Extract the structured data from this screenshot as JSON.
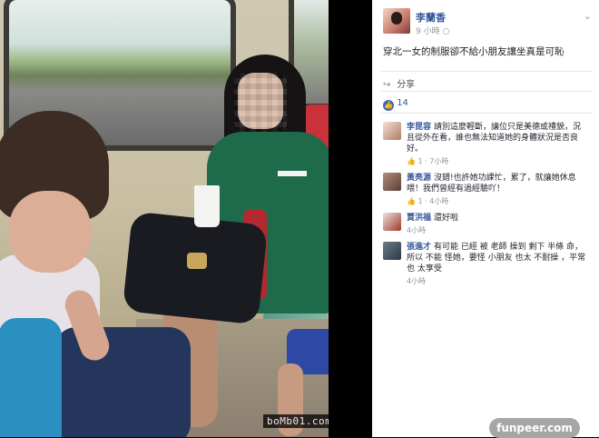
{
  "post": {
    "author": "李蘭香",
    "time": "9 小時",
    "privacy_icon": "globe-icon",
    "text": "穿北一女的制服卻不給小朋友讓坐真是可恥",
    "share_label": "分享",
    "like_count": "14"
  },
  "comments": [
    {
      "name": "李昆容",
      "text": "請別這麼輕斷，讓位只是美德或禮貌，況且從外在看，誰也無法知道她的身體狀況是否良好。",
      "like_count": "1",
      "time": "7小時"
    },
    {
      "name": "黃亮源",
      "text": "沒錯!也許她功課忙，累了，就讓她休息喂！我們曾經有過經驗吖！",
      "like_count": "1",
      "time": "4小時"
    },
    {
      "name": "賈洪福",
      "text": "還好啦",
      "like_count": "",
      "time": "4小時"
    },
    {
      "name": "張進才",
      "text": "有可能 已經 被 老師 操到 剩下 半條 命，所以 不能 怪她，要怪 小朋友 也太 不耐操 ，平常也 太享受",
      "like_count": "",
      "time": "4小時"
    }
  ],
  "watermarks": {
    "photo": "boMb01.com",
    "site": "funpeer.com"
  },
  "colors": {
    "link": "#365899",
    "like_blue": "#4267b2",
    "meta_gray": "#90949c"
  }
}
